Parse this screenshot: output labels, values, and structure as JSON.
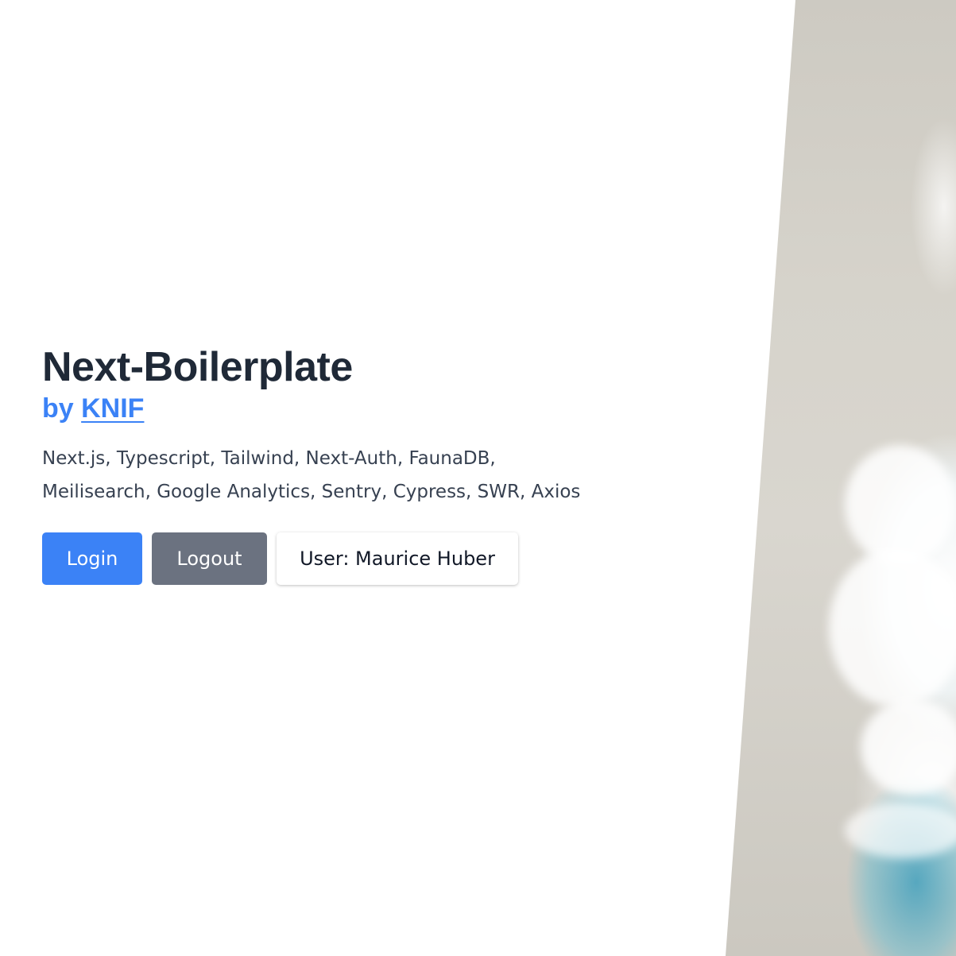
{
  "hero": {
    "title": "Next-Boilerplate",
    "by_prefix": "by ",
    "by_link": "KNIF",
    "description_line1": "Next.js, Typescript, Tailwind, Next-Auth, FaunaDB,",
    "description_line2": "Meilisearch, Google Analytics, Sentry, Cypress, SWR, Axios"
  },
  "actions": {
    "login_label": "Login",
    "logout_label": "Logout",
    "user_label": "User: Maurice Huber"
  },
  "colors": {
    "primary": "#3b82f6",
    "secondary": "#6b7280",
    "title": "#1f2937",
    "body_text": "#374151"
  }
}
